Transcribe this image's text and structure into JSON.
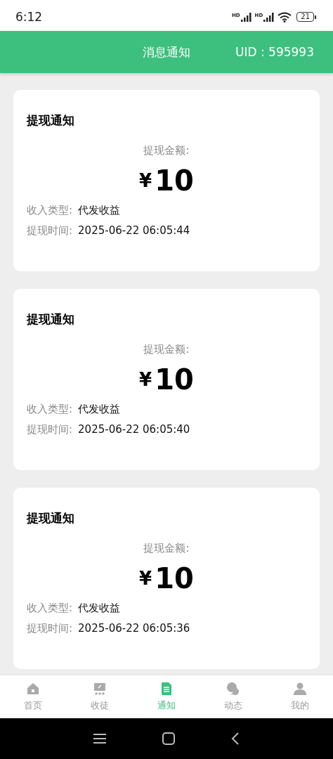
{
  "status_bar": {
    "time": "6:12",
    "signals": [
      "HD",
      "HD"
    ],
    "battery": "21"
  },
  "header": {
    "title": "消息通知",
    "uid": "UID : 595993"
  },
  "notifications": [
    {
      "title": "提现通知",
      "amount_label": "提现金额:",
      "currency": "¥",
      "amount": "10",
      "fields": [
        {
          "label": "收入类型:",
          "value": "代发收益"
        },
        {
          "label": "提现时间:",
          "value": "2025-06-22 06:05:44"
        }
      ]
    },
    {
      "title": "提现通知",
      "amount_label": "提现金额:",
      "currency": "¥",
      "amount": "10",
      "fields": [
        {
          "label": "收入类型:",
          "value": "代发收益"
        },
        {
          "label": "提现时间:",
          "value": "2025-06-22 06:05:40"
        }
      ]
    },
    {
      "title": "提现通知",
      "amount_label": "提现金额:",
      "currency": "¥",
      "amount": "10",
      "fields": [
        {
          "label": "收入类型:",
          "value": "代发收益"
        },
        {
          "label": "提现时间:",
          "value": "2025-06-22 06:05:36"
        }
      ]
    }
  ],
  "tab_bar": [
    {
      "kind": "home",
      "label": "首页",
      "selected": false
    },
    {
      "kind": "recruit",
      "label": "收徒",
      "selected": false
    },
    {
      "kind": "notice",
      "label": "通知",
      "selected": true
    },
    {
      "kind": "chat",
      "label": "动态",
      "selected": false
    },
    {
      "kind": "user",
      "label": "我的",
      "selected": false
    }
  ]
}
